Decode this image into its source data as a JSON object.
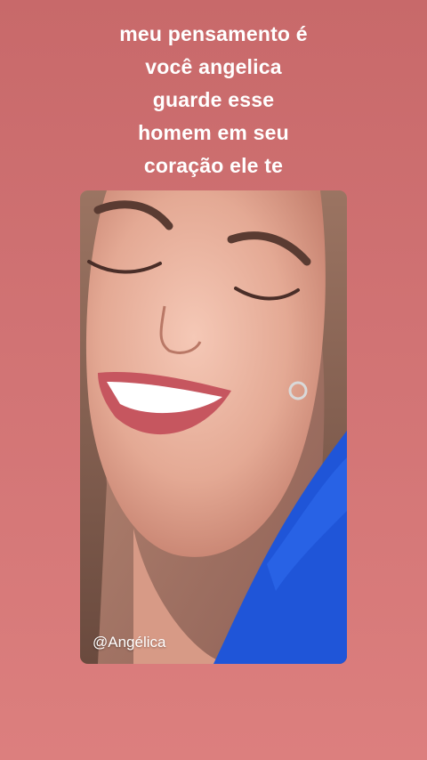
{
  "story": {
    "caption_lines": [
      "meu pensamento é",
      "você angelica",
      "guarde esse",
      "homem em seu",
      "coração ele te"
    ]
  },
  "video": {
    "handle": "@Angélica"
  },
  "colors": {
    "background_top": "#c8696a",
    "background_bottom": "#dc7f7e",
    "caption_text": "#ffffff",
    "top_accent": "#1f55d8"
  }
}
